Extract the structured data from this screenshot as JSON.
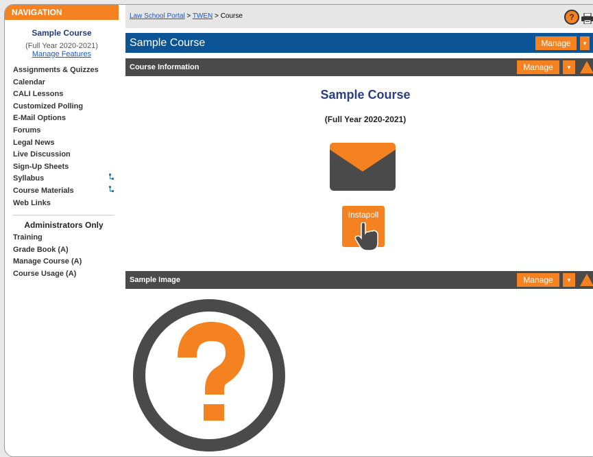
{
  "sidebar": {
    "header": "NAVIGATION",
    "course_title": "Sample Course",
    "course_term": "(Full Year 2020-2021)",
    "manage_features": "Manage Features",
    "items": [
      {
        "label": "Assignments & Quizzes"
      },
      {
        "label": "Calendar"
      },
      {
        "label": "CALI Lessons"
      },
      {
        "label": "Customized Polling"
      },
      {
        "label": "E-Mail Options"
      },
      {
        "label": "Forums"
      },
      {
        "label": "Legal News"
      },
      {
        "label": "Live Discussion"
      },
      {
        "label": "Sign-Up Sheets"
      },
      {
        "label": "Syllabus"
      },
      {
        "label": "Course Materials"
      },
      {
        "label": "Web Links"
      }
    ],
    "admin_title": "Administrators Only",
    "admin_items": [
      {
        "label": "Training"
      },
      {
        "label": "Grade Book (A)"
      },
      {
        "label": "Manage Course (A)"
      },
      {
        "label": "Course Usage (A)"
      }
    ]
  },
  "breadcrumb": {
    "portal": "Law School Portal",
    "sep1": " > ",
    "twen": "TWEN",
    "sep2": " > ",
    "current": "Course"
  },
  "header": {
    "title": "Sample Course",
    "manage_label": "Manage",
    "dropdown_glyph": "▾"
  },
  "section_info": {
    "title": "Course Information",
    "manage_label": "Manage",
    "course_title": "Sample Course",
    "course_term": "(Full Year 2020-2021)",
    "instapoll_label": "Instapoll"
  },
  "section_image": {
    "title": "Sample Image",
    "manage_label": "Manage"
  },
  "help_glyph": "?",
  "colors": {
    "accent": "#f58220",
    "header_blue": "#0b5596",
    "section_dark": "#4a4a4a",
    "title_blue": "#2b3e80",
    "link_blue": "#1a57c5"
  }
}
